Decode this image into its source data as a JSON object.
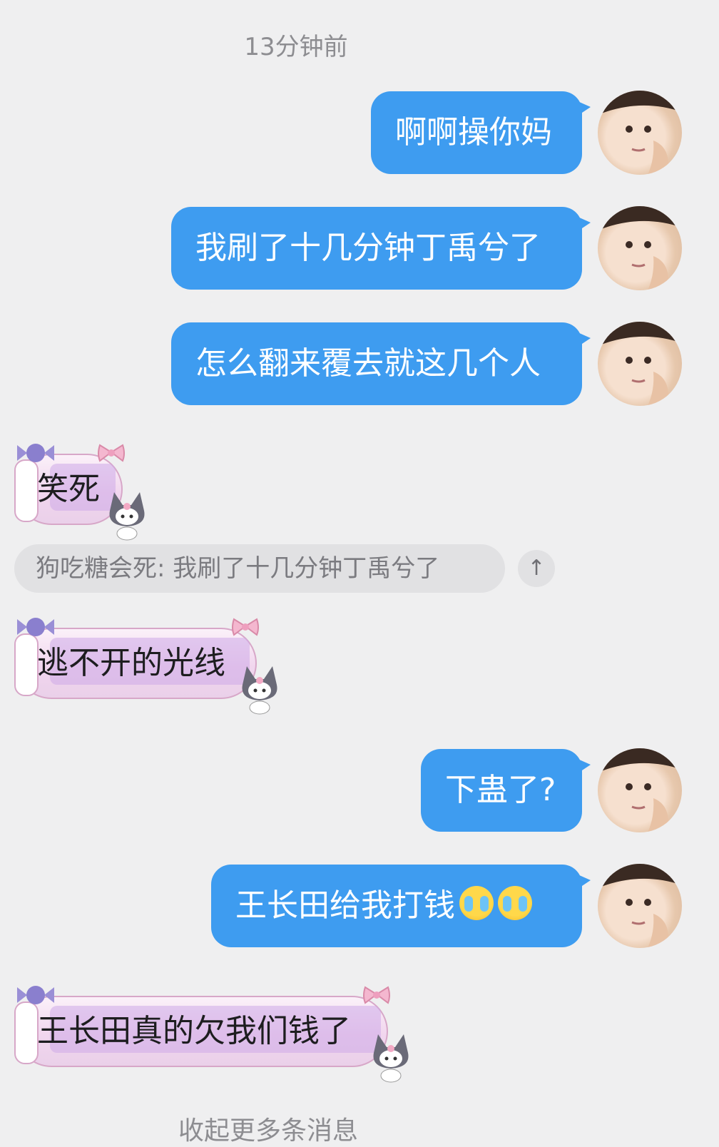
{
  "timestamp": "13分钟前",
  "outgoing": [
    {
      "text": "啊啊操你妈"
    },
    {
      "text": "我刷了十几分钟丁禹兮了"
    },
    {
      "text": "怎么翻来覆去就这几个人"
    },
    {
      "text": "下蛊了?"
    },
    {
      "text": "王长田给我打钱",
      "emojis": [
        "crying-face",
        "crying-face"
      ]
    }
  ],
  "incoming": [
    {
      "text": "笑死"
    },
    {
      "text": "逃不开的光线"
    },
    {
      "text": "王长田真的欠我们钱了"
    }
  ],
  "quote": {
    "text": "狗吃糖会死: 我刷了十几分钟丁禹兮了",
    "jump_glyph": "↑"
  },
  "footer": "收起更多条消息",
  "colors": {
    "outgoing_bubble": "#3e9cf0",
    "background": "#efeff0",
    "incoming_bubble": "#f1d6ee"
  }
}
